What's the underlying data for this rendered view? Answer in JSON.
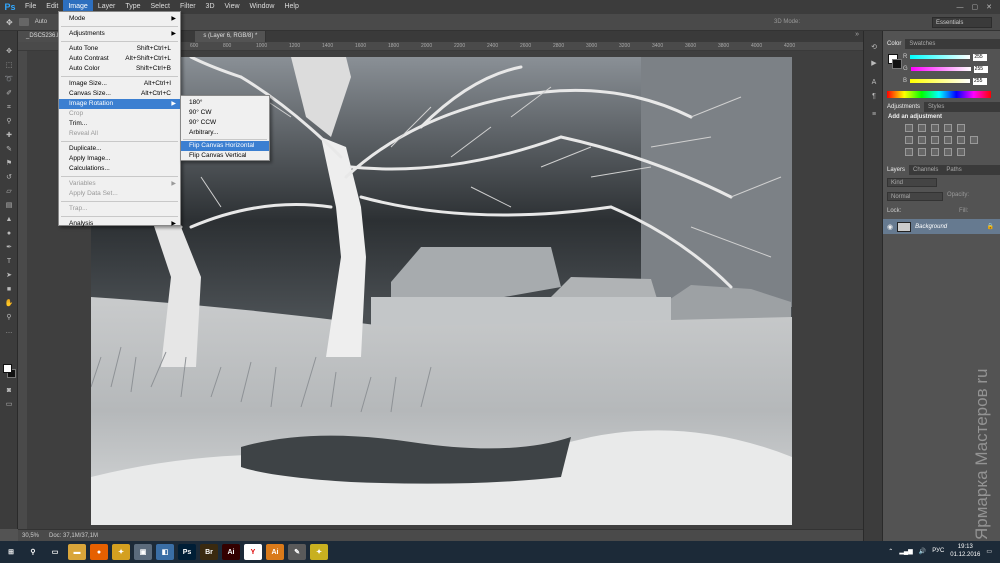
{
  "app": {
    "logo": "Ps"
  },
  "menubar": {
    "items": [
      "File",
      "Edit",
      "Image",
      "Layer",
      "Type",
      "Select",
      "Filter",
      "3D",
      "View",
      "Window",
      "Help"
    ],
    "active": "Image"
  },
  "options": {
    "auto_label": "Auto",
    "mode_label": "3D Mode:",
    "workspace": "Essentials"
  },
  "tabs": [
    {
      "label": "_DSC5236.N..."
    },
    {
      "label": "s (Layer 6, RGB/8) *"
    }
  ],
  "ruler": {
    "ticks": [
      "150",
      "0",
      "200",
      "400",
      "600",
      "800",
      "1000",
      "1200",
      "1400",
      "1600",
      "1800",
      "2000",
      "2200",
      "2400",
      "2600",
      "2800",
      "3000",
      "3200",
      "3400",
      "3600",
      "3800",
      "4000",
      "4200"
    ]
  },
  "status": {
    "zoom": "30,5%",
    "doc": "Doc: 37,1M/37,1M"
  },
  "image_menu": {
    "items": [
      {
        "label": "Mode",
        "submenu": true
      },
      {
        "separator": true
      },
      {
        "label": "Adjustments",
        "submenu": true
      },
      {
        "separator": true
      },
      {
        "label": "Auto Tone",
        "shortcut": "Shift+Ctrl+L"
      },
      {
        "label": "Auto Contrast",
        "shortcut": "Alt+Shift+Ctrl+L"
      },
      {
        "label": "Auto Color",
        "shortcut": "Shift+Ctrl+B"
      },
      {
        "separator": true
      },
      {
        "label": "Image Size...",
        "shortcut": "Alt+Ctrl+I"
      },
      {
        "label": "Canvas Size...",
        "shortcut": "Alt+Ctrl+C"
      },
      {
        "label": "Image Rotation",
        "submenu": true,
        "highlight": true
      },
      {
        "label": "Crop",
        "disabled": true
      },
      {
        "label": "Trim..."
      },
      {
        "label": "Reveal All",
        "disabled": true
      },
      {
        "separator": true
      },
      {
        "label": "Duplicate..."
      },
      {
        "label": "Apply Image..."
      },
      {
        "label": "Calculations..."
      },
      {
        "separator": true
      },
      {
        "label": "Variables",
        "submenu": true,
        "disabled": true
      },
      {
        "label": "Apply Data Set...",
        "disabled": true
      },
      {
        "separator": true
      },
      {
        "label": "Trap...",
        "disabled": true
      },
      {
        "separator": true
      },
      {
        "label": "Analysis",
        "submenu": true
      }
    ]
  },
  "rotation_menu": {
    "items": [
      {
        "label": "180°"
      },
      {
        "label": "90° CW"
      },
      {
        "label": "90° CCW"
      },
      {
        "label": "Arbitrary..."
      },
      {
        "separator": true
      },
      {
        "label": "Flip Canvas Horizontal",
        "highlight": true
      },
      {
        "label": "Flip Canvas Vertical"
      }
    ]
  },
  "color_panel": {
    "tabs": [
      "Color",
      "Swatches"
    ],
    "channels": [
      {
        "label": "R",
        "value": "255",
        "gradient": "linear-gradient(to right,#00ffff,#ffffff)"
      },
      {
        "label": "G",
        "value": "255",
        "gradient": "linear-gradient(to right,#ff00ff,#ffffff)"
      },
      {
        "label": "B",
        "value": "255",
        "gradient": "linear-gradient(to right,#ffff00,#ffffff)"
      }
    ]
  },
  "adjustments_panel": {
    "tabs": [
      "Adjustments",
      "Styles"
    ],
    "title": "Add an adjustment"
  },
  "layers_panel": {
    "tabs": [
      "Layers",
      "Channels",
      "Paths"
    ],
    "kind": "Kind",
    "blend_mode": "Normal",
    "opacity_label": "Opacity:",
    "lock_label": "Lock:",
    "fill_label": "Fill:",
    "layer_name": "Background"
  },
  "taskbar": {
    "icons": [
      {
        "name": "start-icon",
        "text": "⊞",
        "color": "#1c2a38"
      },
      {
        "name": "search-icon",
        "text": "⚲",
        "color": "#1c2a38"
      },
      {
        "name": "task-view-icon",
        "text": "▭",
        "color": "#1c2a38"
      },
      {
        "name": "file-explorer-icon",
        "text": "▬",
        "color": "#d9a53a"
      },
      {
        "name": "firefox-icon",
        "text": "●",
        "color": "#e66000"
      },
      {
        "name": "app-icon-x",
        "text": "✦",
        "color": "#d4a020"
      },
      {
        "name": "image-viewer-icon",
        "text": "▣",
        "color": "#5b6b7c"
      },
      {
        "name": "app-icon-blue",
        "text": "◧",
        "color": "#3a6ea5"
      },
      {
        "name": "photoshop-icon",
        "text": "Ps",
        "color": "#001e36"
      },
      {
        "name": "bridge-icon",
        "text": "Br",
        "color": "#3a2a10"
      },
      {
        "name": "illustrator-icon",
        "text": "Ai",
        "color": "#330000"
      },
      {
        "name": "yandex-icon",
        "text": "Y",
        "color": "#ffffff"
      },
      {
        "name": "app-icon-orange",
        "text": "Ai",
        "color": "#d97a1a"
      },
      {
        "name": "app-icon-tools",
        "text": "✎",
        "color": "#5a5a5a"
      },
      {
        "name": "app-icon-star",
        "text": "✦",
        "color": "#c8b020"
      }
    ],
    "language": "РУС",
    "time": "19:13",
    "date": "01.12.2016"
  },
  "watermark": "Ярмарка Мастеров ru"
}
